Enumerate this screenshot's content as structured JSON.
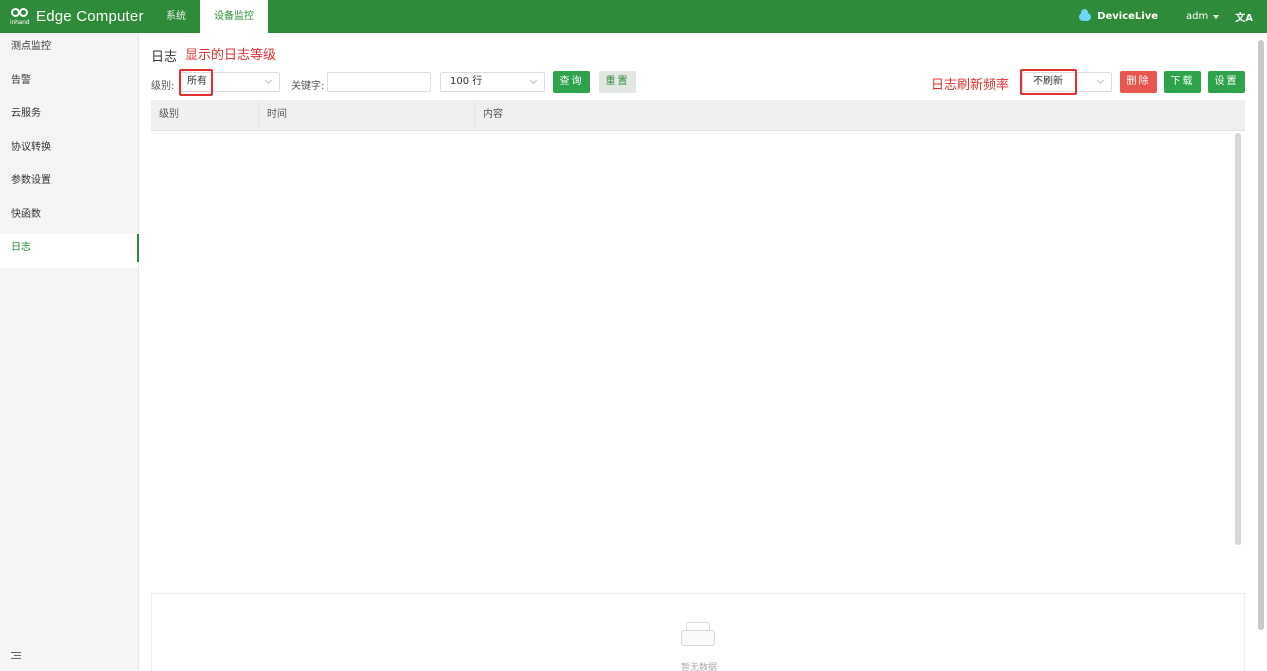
{
  "header": {
    "logo_sub": "inhand",
    "logo_text": "Edge Computer",
    "nav": [
      {
        "label": "系统",
        "active": false
      },
      {
        "label": "设备监控",
        "active": true
      }
    ],
    "devicelive": "DeviceLive",
    "user": "adm",
    "lang_icon": "文A"
  },
  "sidebar": {
    "items": [
      {
        "label": "测点监控"
      },
      {
        "label": "告警"
      },
      {
        "label": "云服务"
      },
      {
        "label": "协议转换"
      },
      {
        "label": "参数设置"
      },
      {
        "label": "快函数"
      },
      {
        "label": "日志",
        "active": true
      }
    ]
  },
  "main": {
    "title": "日志",
    "annotations": {
      "level": "显示的日志等级",
      "refresh": "日志刷新频率"
    },
    "toolbar": {
      "level_label": "级别:",
      "level_value": "所有",
      "keyword_label": "关键字:",
      "keyword_value": "",
      "rows_value": "100 行",
      "query": "查询",
      "reset": "重置",
      "refresh_value": "不刷新",
      "delete": "删除",
      "download": "下载",
      "settings": "设置"
    },
    "table": {
      "columns": [
        "级别",
        "时间",
        "内容"
      ],
      "rows": [],
      "empty_text": "暂无数据"
    }
  },
  "colors": {
    "brand": "#2e8b3a",
    "annotation": "#e03030",
    "danger": "#e8574d"
  }
}
